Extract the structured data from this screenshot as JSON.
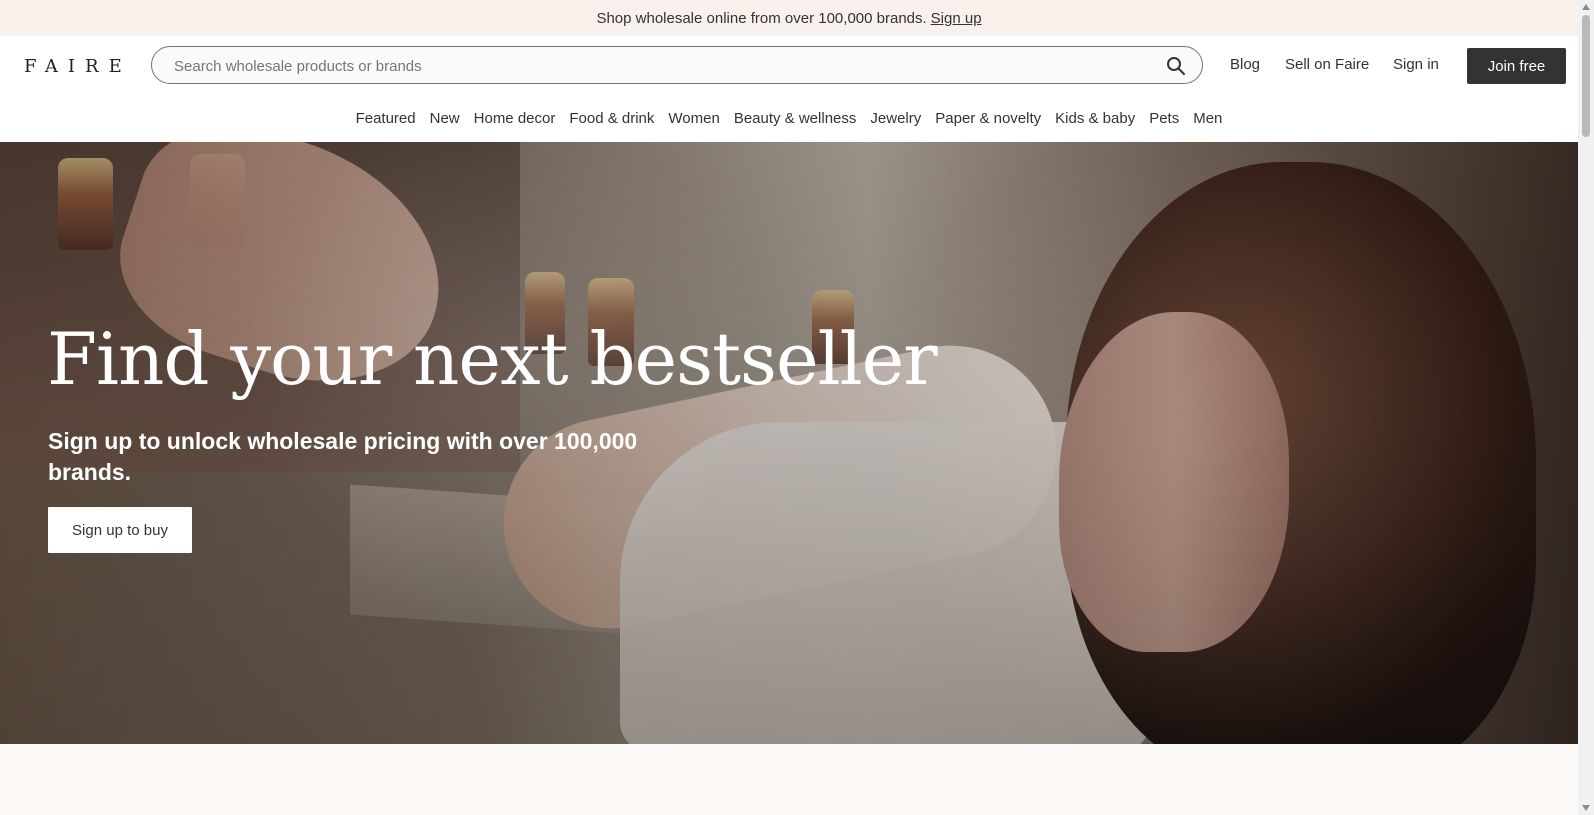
{
  "promo": {
    "text": "Shop wholesale online from over 100,000 brands.",
    "link": "Sign up"
  },
  "header": {
    "logo": "FAIRE",
    "search_placeholder": "Search wholesale products or brands",
    "links": {
      "blog": "Blog",
      "sell": "Sell on Faire",
      "signin": "Sign in"
    },
    "cta": "Join free"
  },
  "categories": [
    "Featured",
    "New",
    "Home decor",
    "Food & drink",
    "Women",
    "Beauty & wellness",
    "Jewelry",
    "Paper & novelty",
    "Kids & baby",
    "Pets",
    "Men"
  ],
  "hero": {
    "title": "Find your next bestseller",
    "subtitle": "Sign up to unlock wholesale pricing with over 100,000 brands.",
    "button": "Sign up to buy"
  },
  "icons": {
    "search": "search-icon"
  },
  "colors": {
    "promo_bg": "#f8f1ec",
    "dark_button": "#333333",
    "page_bg": "#fcf8f5"
  }
}
